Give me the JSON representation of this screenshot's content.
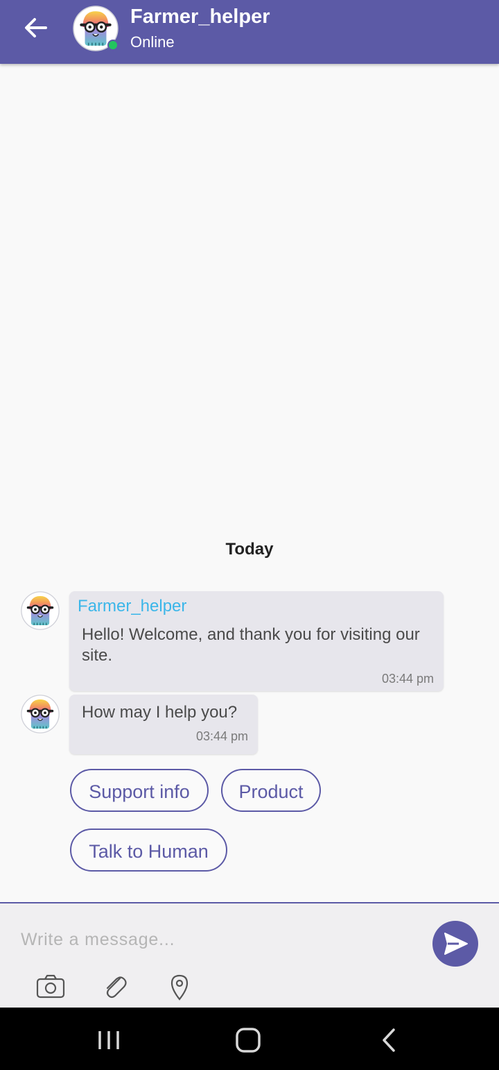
{
  "header": {
    "title": "Farmer_helper",
    "status": "Online",
    "status_color": "#22c55e",
    "back_icon": "arrow-left-icon",
    "background": "#5c5aa6"
  },
  "chat": {
    "date_separator": "Today",
    "messages": [
      {
        "sender": "Farmer_helper",
        "text": "Hello! Welcome, and thank you for visiting our site.",
        "time": "03:44 pm"
      },
      {
        "text": "How may I help you?",
        "time": "03:44 pm"
      }
    ],
    "quick_replies": [
      "Support info",
      "Product",
      "Talk to Human"
    ]
  },
  "composer": {
    "placeholder": "Write a message...",
    "send_icon": "send-icon",
    "tools": [
      "camera-icon",
      "paperclip-icon",
      "location-pin-icon"
    ]
  },
  "navbar": {
    "buttons": [
      "recent-apps-icon",
      "home-icon",
      "back-icon"
    ]
  },
  "colors": {
    "accent": "#5c5aa6",
    "sender_name": "#3bb6e9",
    "bubble": "#e7e6ec"
  }
}
